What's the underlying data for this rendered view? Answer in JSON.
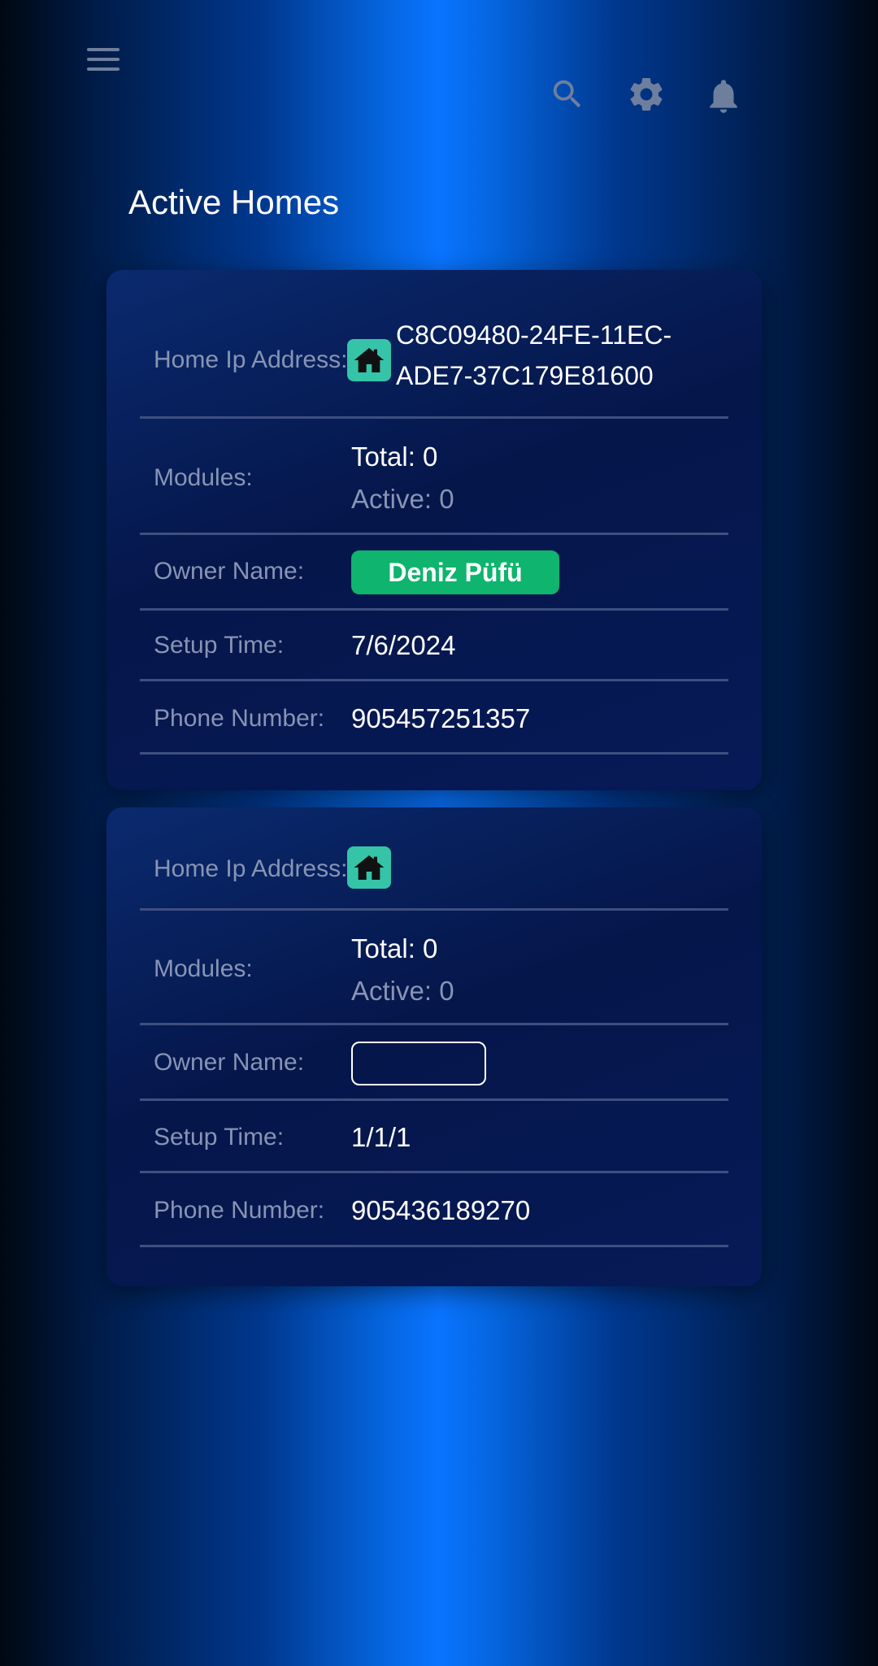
{
  "header": {
    "menu_icon": "hamburger-menu-icon",
    "search_icon": "search-icon",
    "settings_icon": "gear-icon",
    "notifications_icon": "bell-icon",
    "icon_color": "#6e7f9e"
  },
  "page": {
    "title": "Active Homes"
  },
  "colors": {
    "owner_badge": "#0fb46e",
    "home_icon_bg": "#35c4a8",
    "label": "#8794b4",
    "divider": "#3e4f80"
  },
  "homes": [
    {
      "ip_label": "Home Ip Address:",
      "ip_line1": "C8C09480-24FE-11EC-",
      "ip_line2": "ADE7-37C179E81600",
      "modules_label": "Modules:",
      "modules_total": "Total: 0",
      "modules_active": "Active: 0",
      "owner_label": "Owner Name:",
      "owner_name": "Deniz Püfü",
      "setup_label": "Setup Time:",
      "setup_time": "7/6/2024",
      "phone_label": "Phone Number:",
      "phone": "905457251357"
    },
    {
      "ip_label": "Home Ip Address:",
      "ip_line1": "",
      "ip_line2": "",
      "modules_label": "Modules:",
      "modules_total": "Total: 0",
      "modules_active": "Active: 0",
      "owner_label": "Owner Name:",
      "owner_name": "",
      "setup_label": "Setup Time:",
      "setup_time": "1/1/1",
      "phone_label": "Phone Number:",
      "phone": "905436189270"
    }
  ]
}
